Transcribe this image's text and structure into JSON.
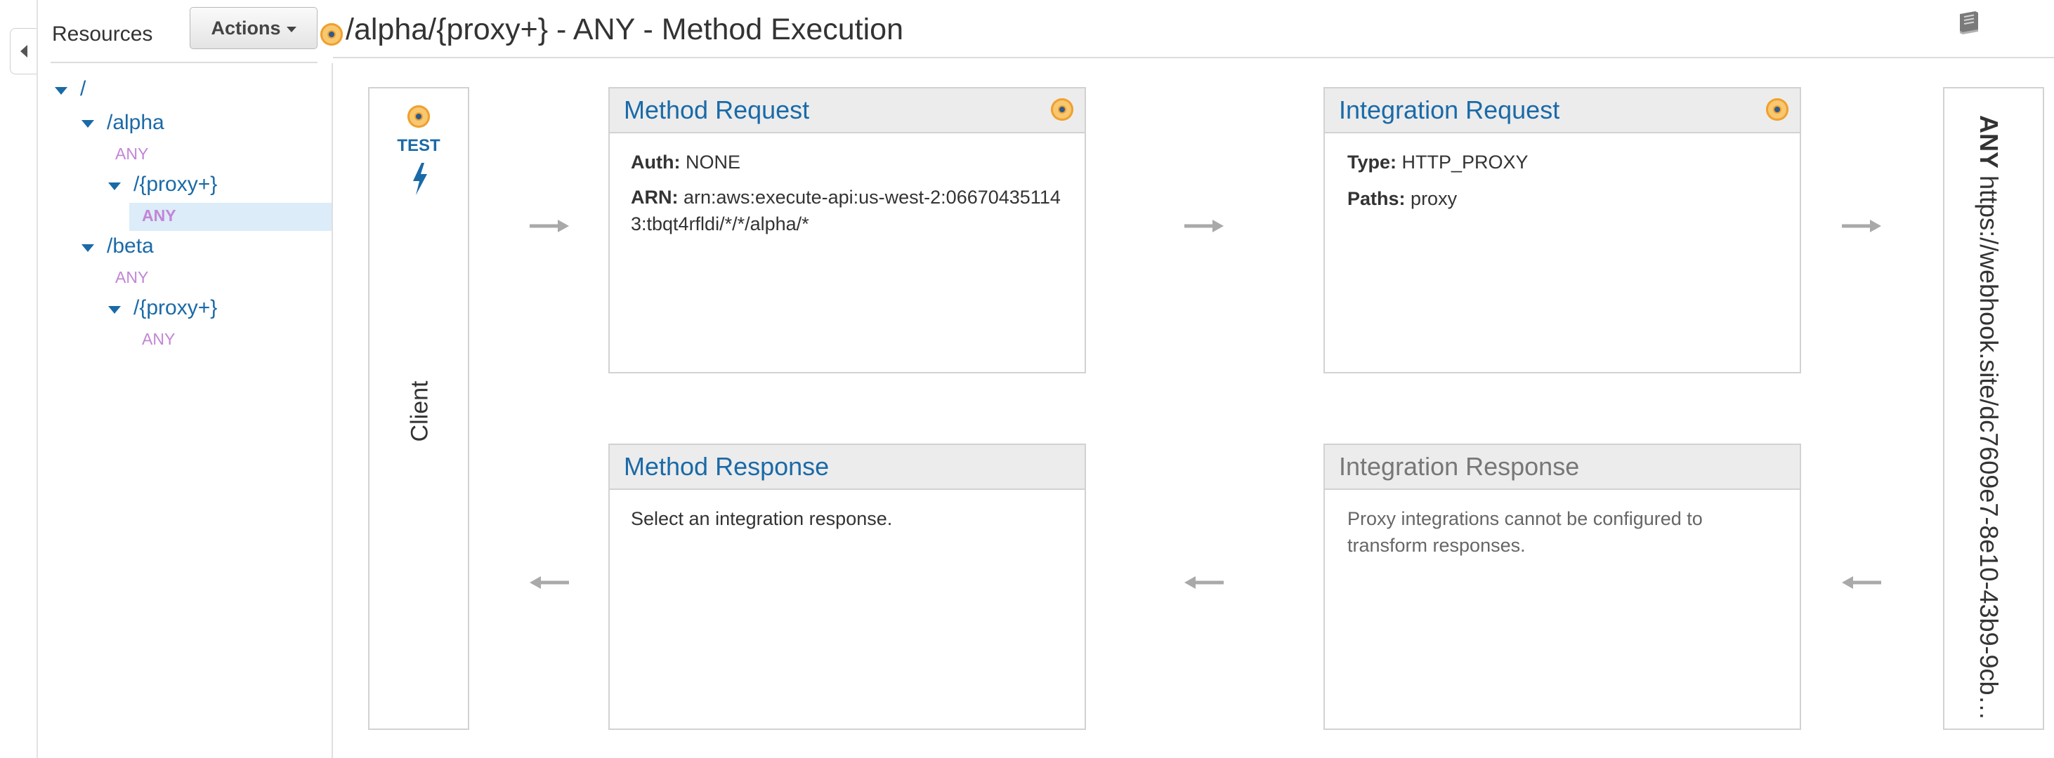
{
  "sidebar": {
    "title": "Resources",
    "actions_label": "Actions",
    "tree": {
      "root": "/",
      "alpha": "/alpha",
      "alpha_any": "ANY",
      "alpha_proxy": "/{proxy+}",
      "alpha_proxy_any": "ANY",
      "beta": "/beta",
      "beta_any": "ANY",
      "beta_proxy": "/{proxy+}",
      "beta_proxy_any": "ANY"
    }
  },
  "header": {
    "title": "/alpha/{proxy+} - ANY - Method Execution"
  },
  "client": {
    "test_label": "TEST",
    "label": "Client"
  },
  "method_request": {
    "title": "Method Request",
    "auth_label": "Auth:",
    "auth_value": "NONE",
    "arn_label": "ARN:",
    "arn_value": "arn:aws:execute-api:us-west-2:066704351143:tbqt4rfldi/*/*/alpha/*"
  },
  "integration_request": {
    "title": "Integration Request",
    "type_label": "Type:",
    "type_value": "HTTP_PROXY",
    "paths_label": "Paths:",
    "paths_value": "proxy"
  },
  "method_response": {
    "title": "Method Response",
    "body": "Select an integration response."
  },
  "integration_response": {
    "title": "Integration Response",
    "body": "Proxy integrations cannot be configured to transform responses."
  },
  "endpoint": {
    "method": "ANY",
    "url": "https://webhook.site/dc7609e7-8e10-43b9-9cb…"
  },
  "colors": {
    "link": "#1a6aa8",
    "method": "#c285d6",
    "accent": "#f0a030",
    "selected_bg": "#dcecf9"
  },
  "icons": [
    "collapse-left-icon",
    "caret-down-icon",
    "status-dot-icon",
    "lightning-icon",
    "book-icon",
    "arrow-right-icon",
    "arrow-left-icon"
  ]
}
